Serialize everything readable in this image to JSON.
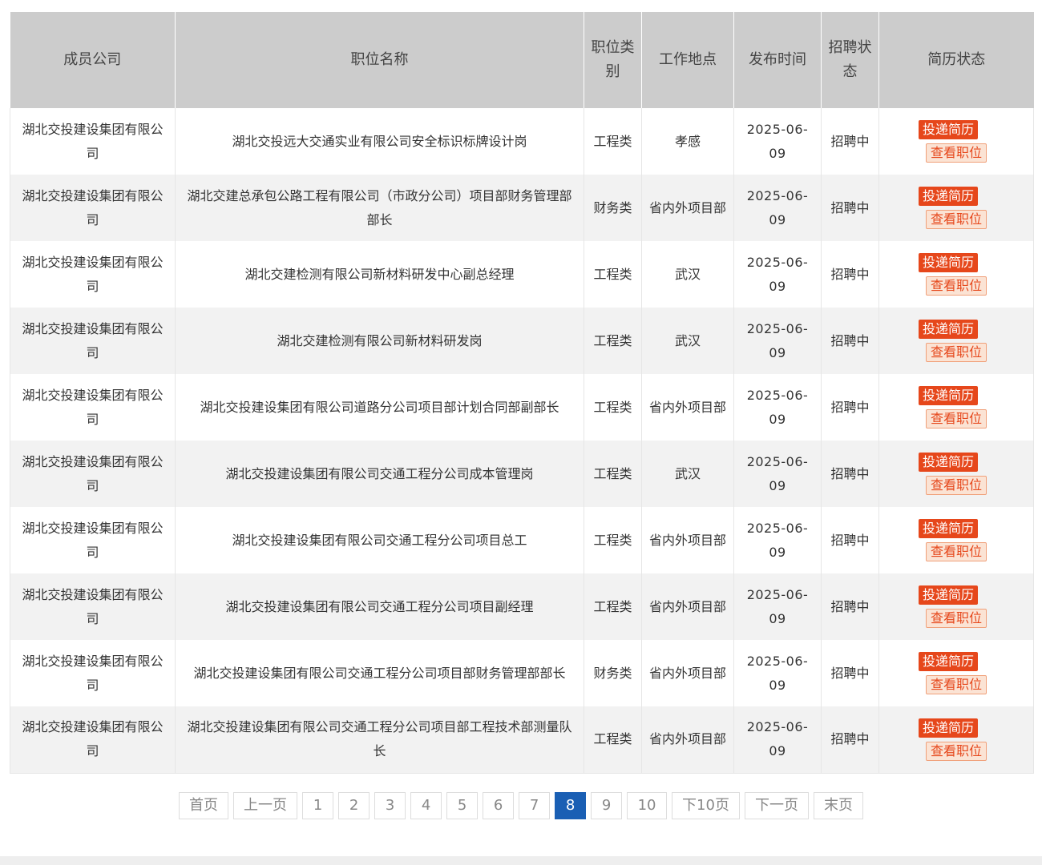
{
  "columns": [
    "成员公司",
    "职位名称",
    "职位类别",
    "工作地点",
    "发布时间",
    "招聘状态",
    "简历状态"
  ],
  "actions": {
    "apply": "投递简历",
    "view": "查看职位"
  },
  "rows": [
    {
      "company": "湖北交投建设集团有限公司",
      "title": "湖北交投远大交通实业有限公司安全标识标牌设计岗",
      "category": "工程类",
      "location": "孝感",
      "date": "2025-06-09",
      "status": "招聘中"
    },
    {
      "company": "湖北交投建设集团有限公司",
      "title": "湖北交建总承包公路工程有限公司（市政分公司）项目部财务管理部部长",
      "category": "财务类",
      "location": "省内外项目部",
      "date": "2025-06-09",
      "status": "招聘中"
    },
    {
      "company": "湖北交投建设集团有限公司",
      "title": "湖北交建检测有限公司新材料研发中心副总经理",
      "category": "工程类",
      "location": "武汉",
      "date": "2025-06-09",
      "status": "招聘中"
    },
    {
      "company": "湖北交投建设集团有限公司",
      "title": "湖北交建检测有限公司新材料研发岗",
      "category": "工程类",
      "location": "武汉",
      "date": "2025-06-09",
      "status": "招聘中"
    },
    {
      "company": "湖北交投建设集团有限公司",
      "title": "湖北交投建设集团有限公司道路分公司项目部计划合同部副部长",
      "category": "工程类",
      "location": "省内外项目部",
      "date": "2025-06-09",
      "status": "招聘中"
    },
    {
      "company": "湖北交投建设集团有限公司",
      "title": "湖北交投建设集团有限公司交通工程分公司成本管理岗",
      "category": "工程类",
      "location": "武汉",
      "date": "2025-06-09",
      "status": "招聘中"
    },
    {
      "company": "湖北交投建设集团有限公司",
      "title": "湖北交投建设集团有限公司交通工程分公司项目总工",
      "category": "工程类",
      "location": "省内外项目部",
      "date": "2025-06-09",
      "status": "招聘中"
    },
    {
      "company": "湖北交投建设集团有限公司",
      "title": "湖北交投建设集团有限公司交通工程分公司项目副经理",
      "category": "工程类",
      "location": "省内外项目部",
      "date": "2025-06-09",
      "status": "招聘中"
    },
    {
      "company": "湖北交投建设集团有限公司",
      "title": "湖北交投建设集团有限公司交通工程分公司项目部财务管理部部长",
      "category": "财务类",
      "location": "省内外项目部",
      "date": "2025-06-09",
      "status": "招聘中"
    },
    {
      "company": "湖北交投建设集团有限公司",
      "title": "湖北交投建设集团有限公司交通工程分公司项目部工程技术部测量队长",
      "category": "工程类",
      "location": "省内外项目部",
      "date": "2025-06-09",
      "status": "招聘中"
    }
  ],
  "pagination": {
    "first": "首页",
    "prev": "上一页",
    "pages": [
      "1",
      "2",
      "3",
      "4",
      "5",
      "6",
      "7",
      "8",
      "9",
      "10"
    ],
    "current": "8",
    "next10": "下10页",
    "next": "下一页",
    "last": "末页"
  },
  "colors": {
    "header_bg": "#cccccc",
    "apply_bg": "#e6471b",
    "view_bg": "#fbe3d4",
    "active_page": "#1a5fb4"
  }
}
